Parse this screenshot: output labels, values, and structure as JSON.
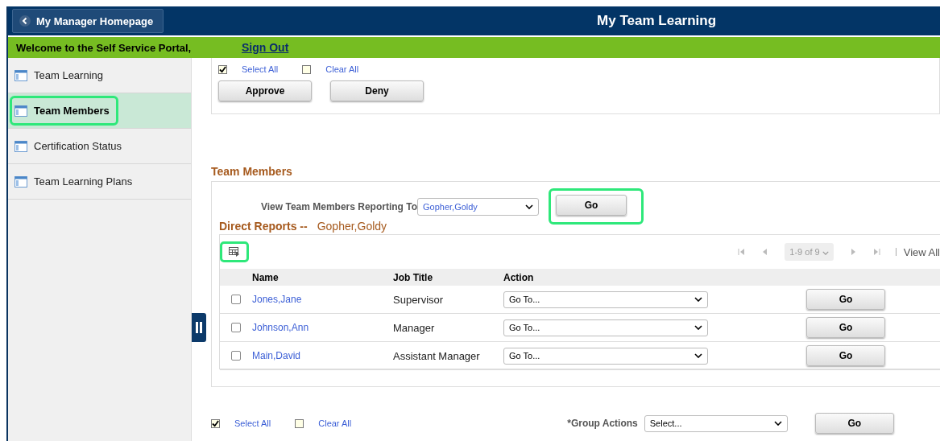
{
  "header": {
    "back_button": "My Manager Homepage",
    "title": "My Team Learning"
  },
  "welcome_bar": {
    "text": "Welcome to the Self Service Portal,",
    "sign_out": "Sign Out"
  },
  "sidebar": {
    "items": [
      {
        "label": "Team Learning",
        "selected": false,
        "highlighted": false
      },
      {
        "label": "Team Members",
        "selected": true,
        "highlighted": true
      },
      {
        "label": "Certification Status",
        "selected": false,
        "highlighted": false
      },
      {
        "label": "Team Learning Plans",
        "selected": false,
        "highlighted": false
      }
    ]
  },
  "top_actions": {
    "select_all": {
      "label": "Select All",
      "checked": true
    },
    "clear_all": {
      "label": "Clear All",
      "checked": false
    },
    "buttons": [
      "Approve",
      "Deny"
    ]
  },
  "team_members": {
    "heading": "Team Members",
    "reporting_label": "View Team Members Reporting To",
    "reporting_value": "Gopher,Goldy",
    "go_button": "Go",
    "go_highlighted": true,
    "direct_reports_label": "Direct Reports --",
    "direct_reports_name": "Gopher,Goldy",
    "grid_icon_highlighted": true,
    "pager": {
      "range": "1-9 of 9",
      "view_all": "View All"
    },
    "columns": [
      "Name",
      "Job Title",
      "Action"
    ],
    "rows": [
      {
        "name": "Jones,Jane",
        "job_title": "Supervisor",
        "action": "Go To...",
        "button": "Go",
        "checked": false
      },
      {
        "name": "Johnson,Ann",
        "job_title": "Manager",
        "action": "Go To...",
        "button": "Go",
        "checked": false
      },
      {
        "name": "Main,David",
        "job_title": "Assistant Manager",
        "action": "Go To...",
        "button": "Go",
        "checked": false
      }
    ]
  },
  "bottom_actions": {
    "select_all": {
      "label": "Select All",
      "checked": true
    },
    "clear_all": {
      "label": "Clear All",
      "checked": false
    },
    "group_actions_label": "*Group Actions",
    "group_actions_value": "Select...",
    "go_button": "Go"
  }
}
